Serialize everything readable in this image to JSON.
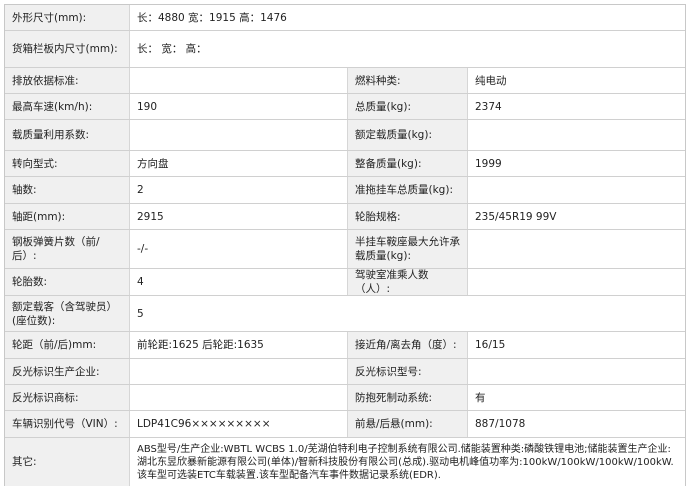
{
  "rows": [
    {
      "label": "外形尺寸(mm):",
      "value": "长：4880 宽：1915 高：1476"
    },
    {
      "label": "货箱栏板内尺寸(mm):",
      "value": "长： 宽： 高："
    },
    {
      "label": "排放依据标准:",
      "value": "",
      "label2": "燃料种类:",
      "value2": "纯电动"
    },
    {
      "label": "最高车速(km/h):",
      "value": "190",
      "label2": "总质量(kg):",
      "value2": "2374"
    },
    {
      "label": "载质量利用系数:",
      "value": "",
      "label2": "额定载质量(kg):",
      "value2": ""
    },
    {
      "label": "转向型式:",
      "value": "方向盘",
      "label2": "整备质量(kg):",
      "value2": "1999"
    },
    {
      "label": "轴数:",
      "value": "2",
      "label2": "准拖挂车总质量(kg):",
      "value2": ""
    },
    {
      "label": "轴距(mm):",
      "value": "2915",
      "label2": "轮胎规格:",
      "value2": "235/45R19 99V"
    },
    {
      "label": "钢板弹簧片数（前/后）:",
      "value": "-/-",
      "label2": "半挂车鞍座最大允许承载质量(kg):",
      "value2": ""
    },
    {
      "label": "轮胎数:",
      "value": "4",
      "label2": "驾驶室准乘人数（人）:",
      "value2": ""
    },
    {
      "label": "额定载客（含驾驶员）(座位数):",
      "value": "5"
    },
    {
      "label": "轮距（前/后)mm:",
      "value": "前轮距:1625 后轮距:1635",
      "label2": "接近角/离去角（度）:",
      "value2": "16/15"
    },
    {
      "label": "反光标识生产企业:",
      "value": "",
      "label2": "反光标识型号:",
      "value2": ""
    },
    {
      "label": "反光标识商标:",
      "value": "",
      "label2": "防抱死制动系统:",
      "value2": "有"
    },
    {
      "label": "车辆识别代号（VIN）:",
      "value": "LDP41C96×××××××××",
      "label2": "前悬/后悬(mm):",
      "value2": "887/1078"
    },
    {
      "label": "其它:",
      "value": "ABS型号/生产企业:WBTL WCBS 1.0/芜湖伯特利电子控制系统有限公司.储能装置种类:磷酸铁锂电池;储能装置生产企业:湖北东昱欣暴新能源有限公司(单体)/智新科技股份有限公司(总成).驱动电机峰值功率为:100kW/100kW/100kW/100kW.该车型可选装ETC车载装置.该车型配备汽车事件数据记录系统(EDR)."
    }
  ]
}
